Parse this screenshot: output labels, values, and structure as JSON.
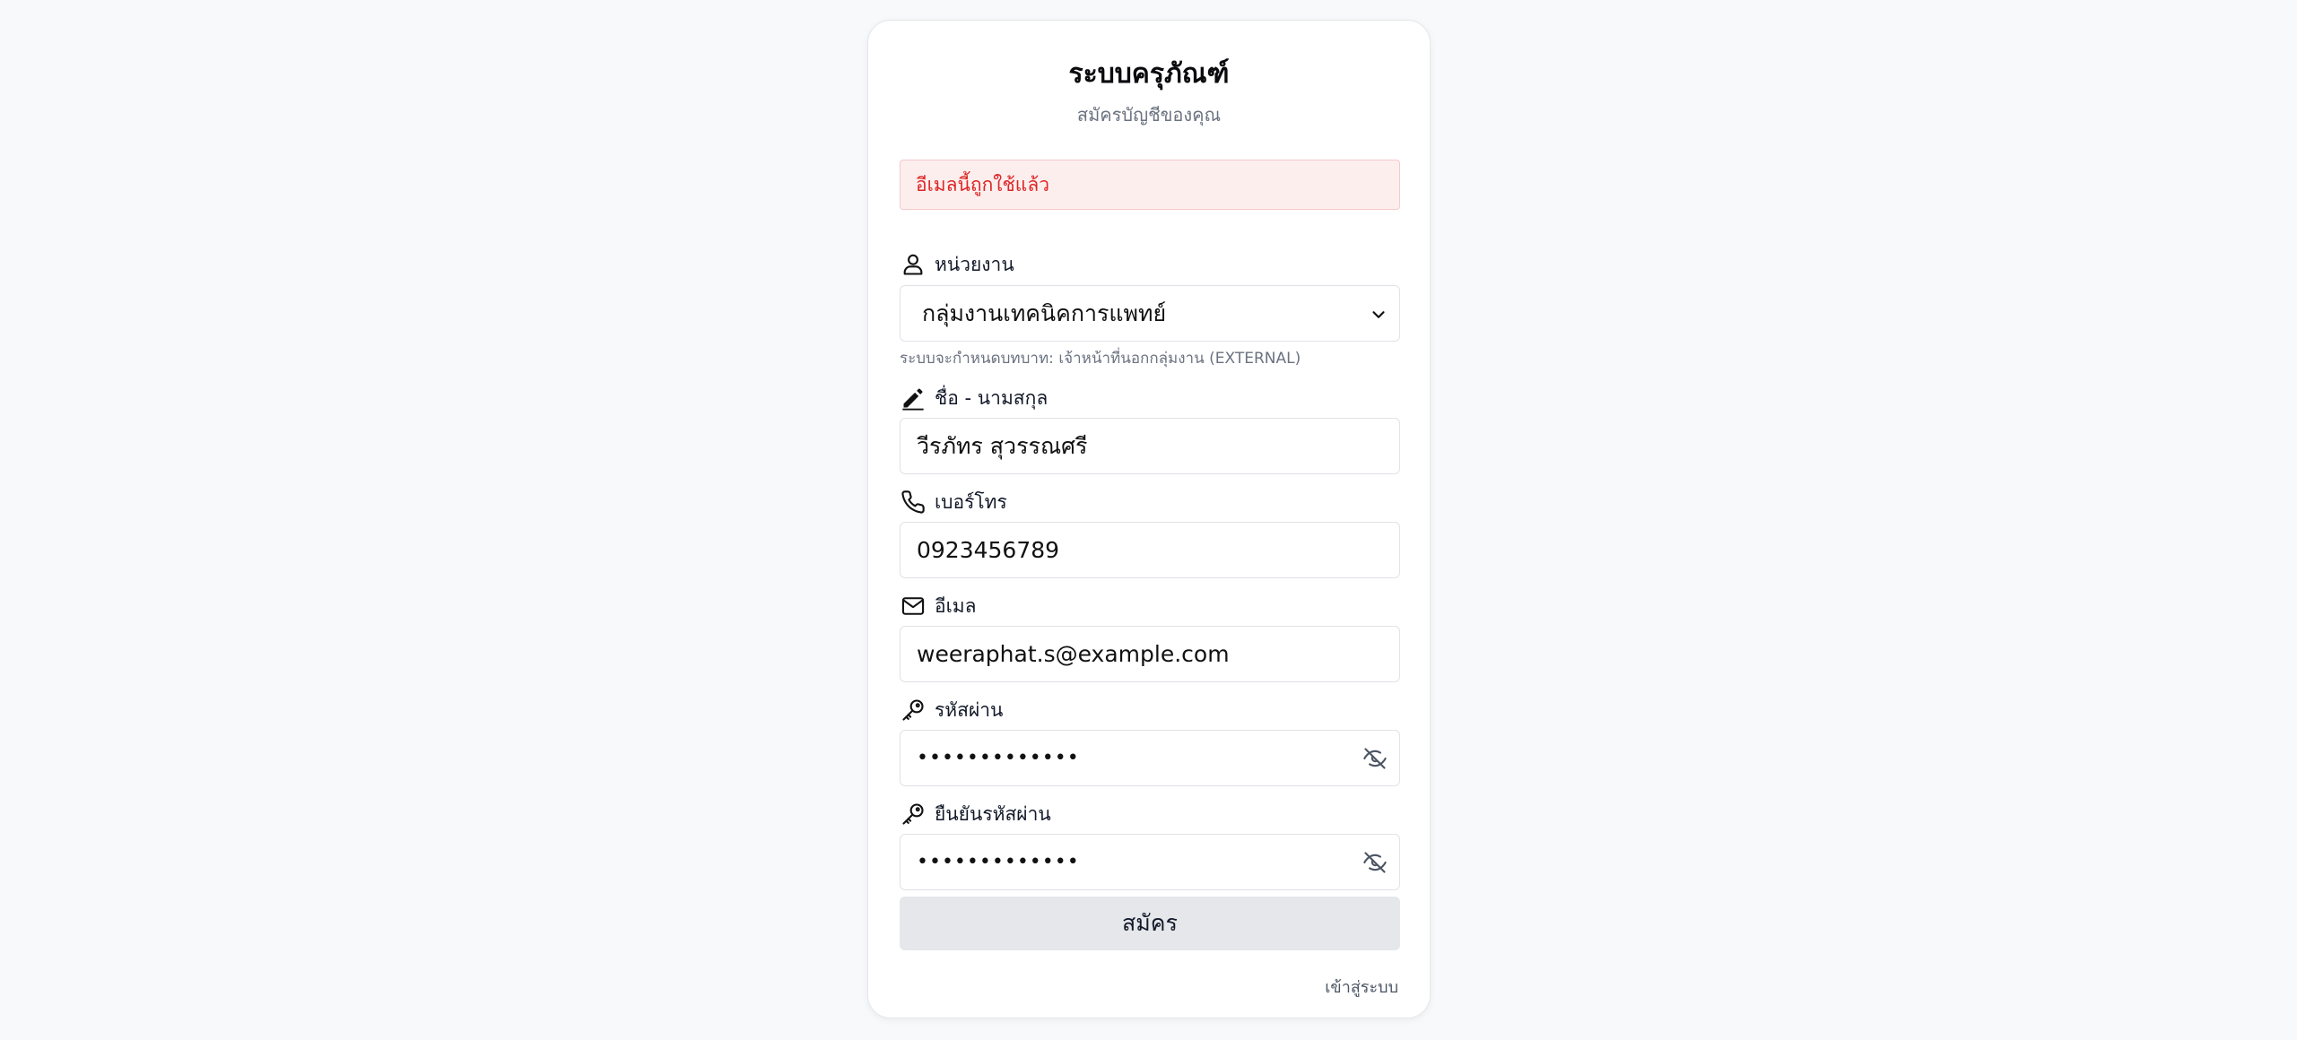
{
  "header": {
    "title": "ระบบครุภัณฑ์",
    "subtitle": "สมัครบัญชีของคุณ"
  },
  "alert": {
    "message": "อีเมลนี้ถูกใช้แล้ว"
  },
  "form": {
    "department": {
      "label": "หน่วยงาน",
      "icon": "user-icon",
      "selected": "กลุ่มงานเทคนิคการแพทย์",
      "helper": "ระบบจะกำหนดบทบาท: เจ้าหน้าที่นอกกลุ่มงาน (EXTERNAL)"
    },
    "full_name": {
      "label": "ชื่อ - นามสกุล",
      "icon": "pencil-icon",
      "value": "วีรภัทร สุวรรณศรี"
    },
    "phone": {
      "label": "เบอร์โทร",
      "icon": "phone-icon",
      "value": "0923456789"
    },
    "email": {
      "label": "อีเมล",
      "icon": "mail-icon",
      "value": "weeraphat.s@example.com"
    },
    "password": {
      "label": "รหัสผ่าน",
      "icon": "key-icon",
      "value": "•••••••••••••",
      "toggle_icon": "eye-off-icon"
    },
    "confirm_password": {
      "label": "ยืนยันรหัสผ่าน",
      "icon": "key-icon",
      "value": "•••••••••••••",
      "toggle_icon": "eye-off-icon"
    },
    "submit_label": "สมัคร"
  },
  "footer": {
    "login_link": "เข้าสู่ระบบ"
  },
  "colors": {
    "alert_text": "#dc2626",
    "alert_bg": "#fdeeee",
    "button_bg": "#e5e7eb",
    "page_bg": "#f8f9fb"
  }
}
